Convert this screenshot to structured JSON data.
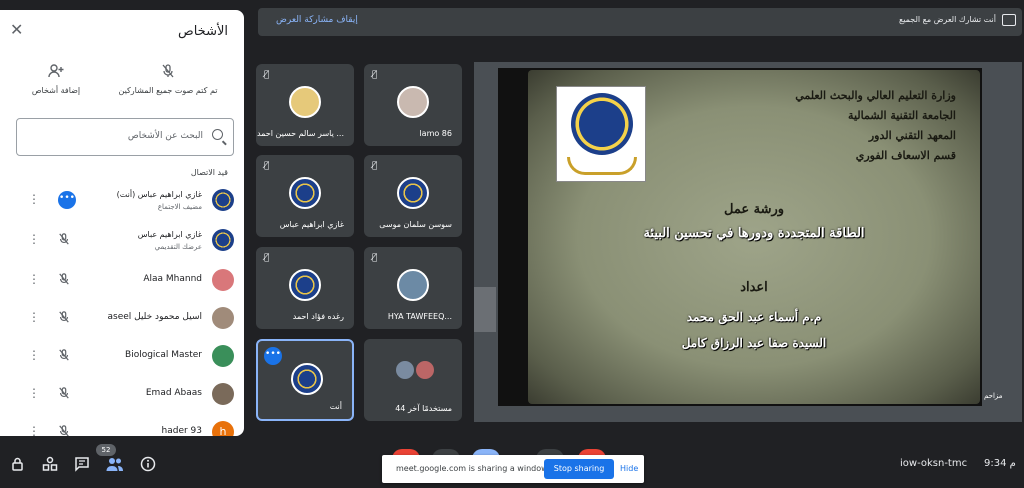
{
  "topbar": {
    "stop_sharing_label": "إيقاف مشاركة العرض",
    "sharing_note": "أنت تشارك العرض مع الجميع"
  },
  "people_panel": {
    "title": "الأشخاص",
    "close_glyph": "✕",
    "actions": [
      {
        "label": "إضافة أشخاص",
        "icon": "add-person-icon",
        "glyph": "👤"
      },
      {
        "label": "تم كتم صوت جميع المشاركين",
        "icon": "mic-off-icon",
        "glyph": "🎙"
      }
    ],
    "search_placeholder": "البحث عن الأشخاص",
    "section_label": "قيد الاتصال",
    "people": [
      {
        "name": "غازي ابراهيم عباس (أنت)",
        "role": "مضيف الاجتماع",
        "avatar_color": "#1c3f8a",
        "status": "more"
      },
      {
        "name": "غازي ابراهيم عباس",
        "role": "عرضك التقديمي",
        "avatar_color": "#1c3f8a",
        "status": "present"
      },
      {
        "name": "Alaa Mhannd",
        "role": "",
        "avatar_color": "#d9777a",
        "status": "muted"
      },
      {
        "name": "aseel اسيل محمود خليل",
        "role": "",
        "avatar_color": "#a08b7a",
        "status": "muted"
      },
      {
        "name": "Biological Master",
        "role": "",
        "avatar_color": "#3a8f5a",
        "status": "muted"
      },
      {
        "name": "Emad Abaas",
        "role": "",
        "avatar_color": "#7a6a5a",
        "status": "muted"
      },
      {
        "name": "hader 93",
        "role": "",
        "avatar_color": "#e8710a",
        "avatar_letter": "h",
        "status": "muted"
      }
    ]
  },
  "tiles": [
    {
      "name": "lamo 86",
      "avatar": "photo",
      "color": "#c9b9b0"
    },
    {
      "name": "ياسر سالم حسين احمد ...",
      "avatar": "photo",
      "color": "#e6c97a"
    },
    {
      "name": "سوسن سلمان موسى",
      "avatar": "emblem"
    },
    {
      "name": "غازي ابراهيم عباس",
      "avatar": "emblem"
    },
    {
      "name": "HYA TAWFEEQ...",
      "avatar": "photo",
      "color": "#6c8aa5"
    },
    {
      "name": "رغده فؤاد احمد",
      "avatar": "emblem"
    },
    {
      "name": "44 مستخدمًا آخر",
      "avatar": "group",
      "color": "#b66"
    },
    {
      "name": "أنت",
      "avatar": "emblem",
      "active": true
    }
  ],
  "slide": {
    "ministry_lines": [
      "وزارة التعليم العالي والبحث العلمي",
      "الجامعة التقنية الشمالية",
      "المعهد التقني الدور",
      "قسم الاسعاف الفوري"
    ],
    "workshop_label": "ورشة عمل",
    "workshop_title": "الطاقة المتجددة ودورها في تحسين البيئة",
    "prepared_by": "اعداد",
    "author_1": "م.م أسماء عبد الحق محمد",
    "author_2": "السيدة صفا عبد الرزاق كامل"
  },
  "right_strip_text": "مزاحم",
  "bottombar": {
    "participants_count": "52",
    "share_message": "meet.google.com is sharing a window.",
    "stop_sharing": "Stop sharing",
    "hide": "Hide",
    "meeting_code": "iow-oksn-tmc",
    "clock": "9:34 م"
  }
}
